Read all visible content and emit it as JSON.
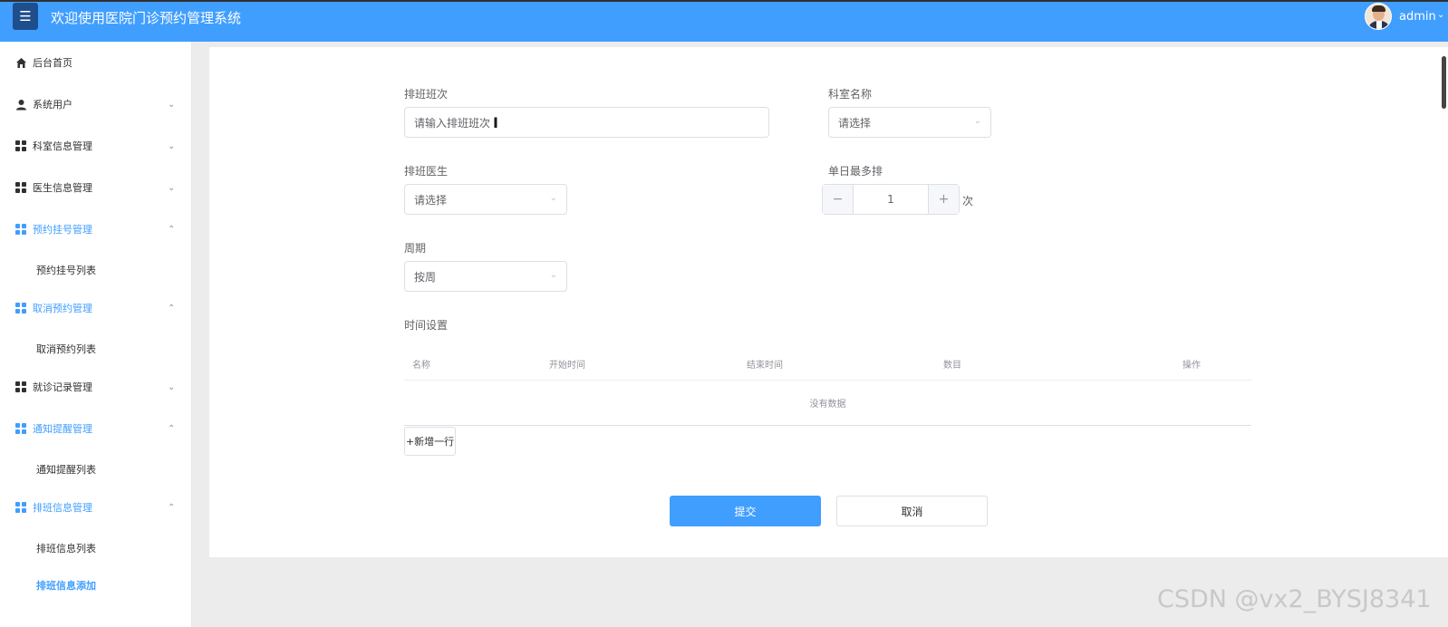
{
  "header": {
    "title": "欢迎使用医院门诊预约管理系统",
    "menu_icon": "menu-icon",
    "user": "admin",
    "user_caret_icon": "chevron-down-icon"
  },
  "sidebar": {
    "items": [
      {
        "label": "后台首页",
        "icon": "home-icon"
      },
      {
        "label": "系统用户",
        "icon": "user-icon",
        "chevron": "⌄"
      },
      {
        "label": "科室信息管理",
        "icon": "grid-icon",
        "chevron": "⌄"
      },
      {
        "label": "医生信息管理",
        "icon": "grid-icon",
        "chevron": "⌄"
      },
      {
        "label": "预约挂号管理",
        "icon": "grid-icon",
        "chevron": "⌃"
      },
      {
        "label": "取消预约管理",
        "icon": "grid-icon",
        "chevron": "⌃"
      },
      {
        "label": "就诊记录管理",
        "icon": "grid-icon",
        "chevron": "⌄"
      },
      {
        "label": "通知提醒管理",
        "icon": "grid-icon",
        "chevron": "⌃"
      },
      {
        "label": "排班信息管理",
        "icon": "grid-icon",
        "chevron": "⌃"
      }
    ],
    "sub_items": {
      "appointment_list": "预约挂号列表",
      "cancel_list": "取消预约列表",
      "notice_list": "通知提醒列表",
      "schedule_list": "排班信息列表",
      "schedule_add": "排班信息添加"
    }
  },
  "form": {
    "shift": {
      "label": "排班班次",
      "placeholder": "请输入排班班次"
    },
    "department": {
      "label": "科室名称",
      "value": "请选择"
    },
    "doctor": {
      "label": "排班医生",
      "value": "请选择"
    },
    "max_per_day": {
      "label": "单日最多排",
      "value": "1",
      "minus": "−",
      "plus": "+",
      "unit": "次"
    },
    "period": {
      "label": "周期",
      "value": "按周"
    },
    "time_settings": {
      "label": "时间设置",
      "columns": [
        "名称",
        "开始时间",
        "结束时间",
        "数目",
        "操作"
      ],
      "empty_text": "没有数据",
      "add_row": "+新增一行"
    },
    "submit": "提交",
    "cancel": "取消"
  },
  "watermark": "CSDN @vx2_BYSJ8341",
  "colors": {
    "primary": "#409eff",
    "header": "#409eff",
    "menu_toggle": "#1f4e8c"
  }
}
